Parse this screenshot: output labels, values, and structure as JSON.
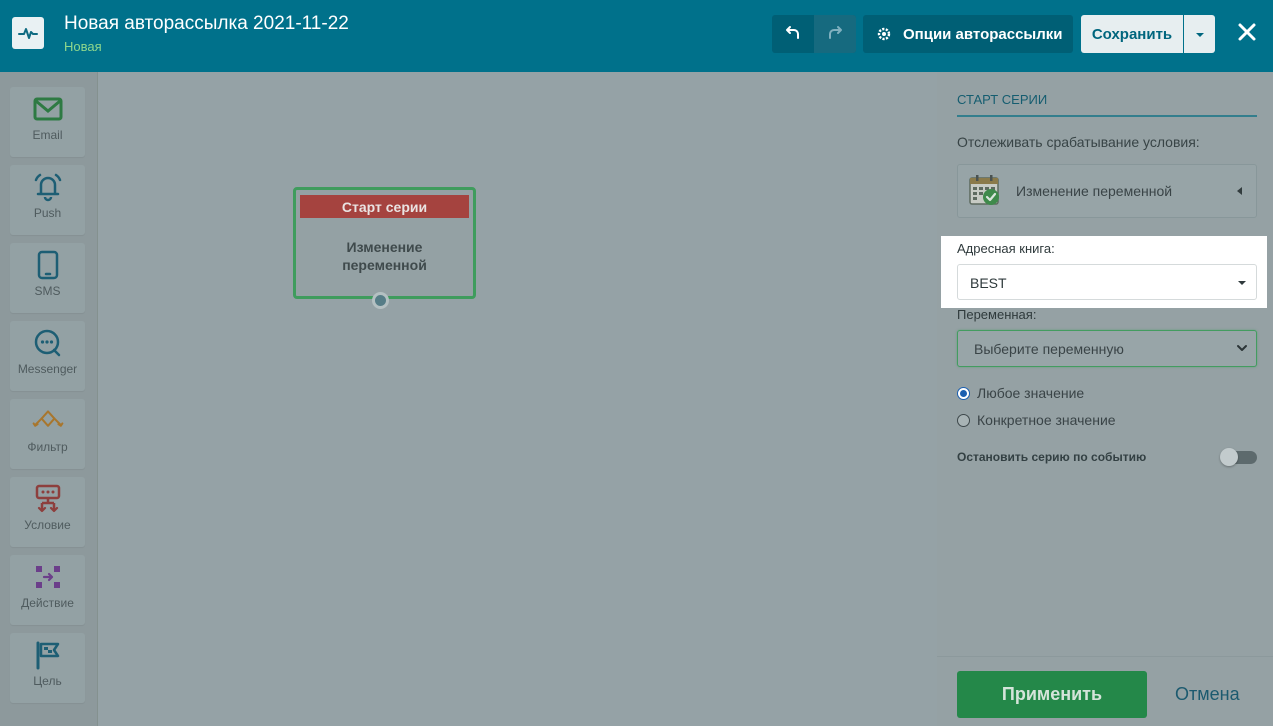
{
  "header": {
    "title": "Новая авторассылка 2021-11-22",
    "status": "Новая",
    "options_label": "Опции авторассылки",
    "save_label": "Сохранить",
    "logo_icon": "pulse-icon",
    "undo_icon": "undo-icon",
    "redo_icon": "redo-icon",
    "close_icon": "close-icon"
  },
  "sidebar": {
    "items": [
      {
        "label": "Email",
        "icon": "envelope-icon",
        "color": "#2e7a43"
      },
      {
        "label": "Push",
        "icon": "bell-icon",
        "color": "#1d5e74"
      },
      {
        "label": "SMS",
        "icon": "phone-icon",
        "color": "#1d5e74"
      },
      {
        "label": "Messenger",
        "icon": "chat-icon",
        "color": "#1d5e74"
      },
      {
        "label": "Фильтр",
        "icon": "filter-icon",
        "color": "#a8762d"
      },
      {
        "label": "Условие",
        "icon": "condition-icon",
        "color": "#8d3f3d"
      },
      {
        "label": "Действие",
        "icon": "action-icon",
        "color": "#6b3e8a"
      },
      {
        "label": "Цель",
        "icon": "flag-icon",
        "color": "#1d5e74"
      }
    ]
  },
  "canvas": {
    "node": {
      "header": "Старт серии",
      "body_line1": "Изменение",
      "body_line2": "переменной"
    }
  },
  "panel": {
    "title": "СТАРТ СЕРИИ",
    "track_label": "Отслеживать срабатывание условия:",
    "condition": "Изменение переменной",
    "address_book_label": "Адресная книга:",
    "address_book_value": "BEST",
    "variable_label": "Переменная:",
    "variable_placeholder": "Выберите переменную",
    "radio_any": "Любое значение",
    "radio_specific": "Конкретное значение",
    "radio_selected": "any",
    "stop_label": "Остановить серию по событию",
    "stop_enabled": false,
    "apply_label": "Применить",
    "cancel_label": "Отмена"
  },
  "colors": {
    "header": "#00718b",
    "accent_green": "#248849",
    "node_header": "#a5433f",
    "overlay": "#95a2a6"
  }
}
